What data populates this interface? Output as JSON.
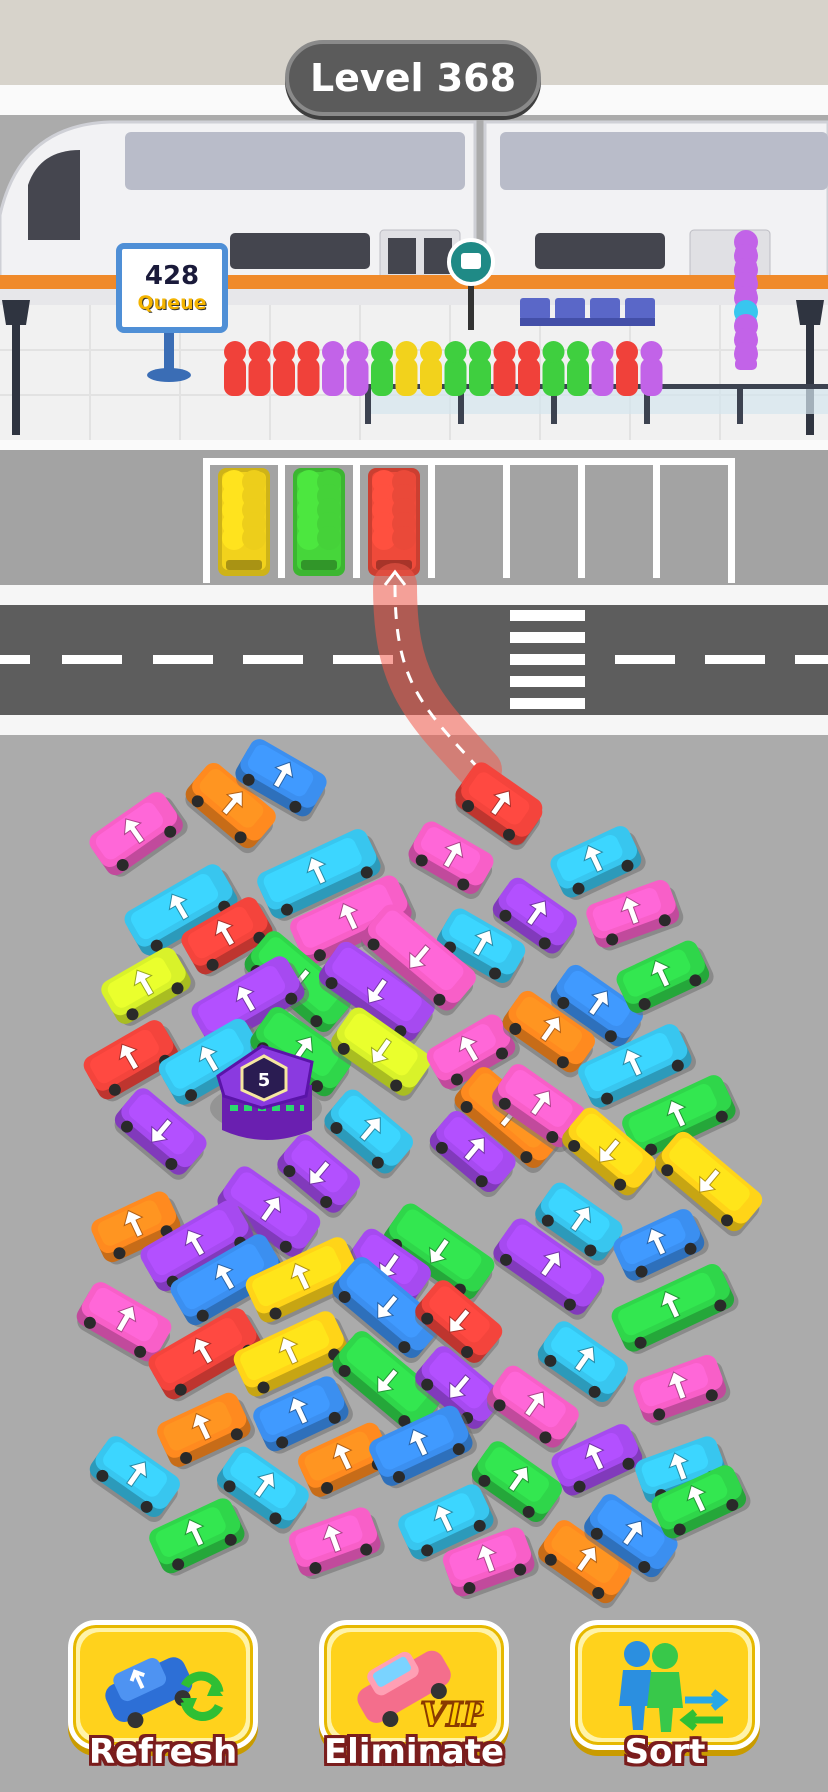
{
  "header": {
    "level_label": "Level 368"
  },
  "queue": {
    "count": "428",
    "label": "Queue"
  },
  "parking": {
    "slots": [
      {
        "color": "#f2d21c"
      },
      {
        "color": "#46d63a"
      },
      {
        "color": "#ef4a3a"
      },
      {
        "color": null
      },
      {
        "color": null
      },
      {
        "color": null
      },
      {
        "color": null
      }
    ]
  },
  "passenger_line": [
    "#f0413a",
    "#f0413a",
    "#f0413a",
    "#f0413a",
    "#c263e8",
    "#c263e8",
    "#3fcf3f",
    "#f2d21c",
    "#f2d21c",
    "#3fcf3f",
    "#3fcf3f",
    "#f0413a",
    "#f0413a",
    "#3fcf3f",
    "#3fcf3f",
    "#c263e8",
    "#f0413a",
    "#c263e8"
  ],
  "mystery_block": {
    "number": "5"
  },
  "vehicles_palette": {
    "pink": "#f85fc8",
    "orange": "#ff8a1f",
    "blue": "#3b8ff0",
    "cyan": "#38c6ef",
    "purple": "#a64af0",
    "green": "#2fd64a",
    "yellow": "#ffd418",
    "red": "#f4443c",
    "lime": "#d9f22a"
  },
  "powerups": [
    {
      "name": "refresh",
      "label": "Refresh"
    },
    {
      "name": "eliminate",
      "label": "Eliminate",
      "badge": "VIP"
    },
    {
      "name": "sort",
      "label": "Sort"
    }
  ]
}
